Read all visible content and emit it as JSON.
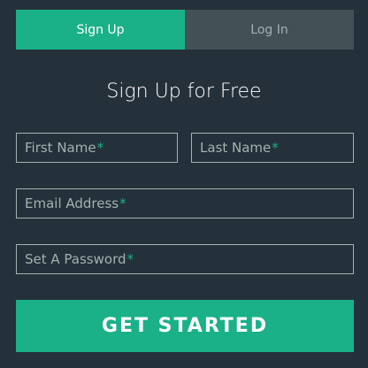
{
  "tabs": {
    "signup_label": "Sign Up",
    "login_label": "Log In"
  },
  "form": {
    "title": "Sign Up for Free",
    "first_name_placeholder": "First Name",
    "last_name_placeholder": "Last Name",
    "email_placeholder": "Email Address",
    "password_placeholder": "Set A Password",
    "required_marker": "*",
    "submit_label": "GET STARTED"
  },
  "colors": {
    "background": "#24313a",
    "accent": "#1ab188",
    "inactive_tab": "#435056",
    "muted_text": "#a0b3b0"
  }
}
